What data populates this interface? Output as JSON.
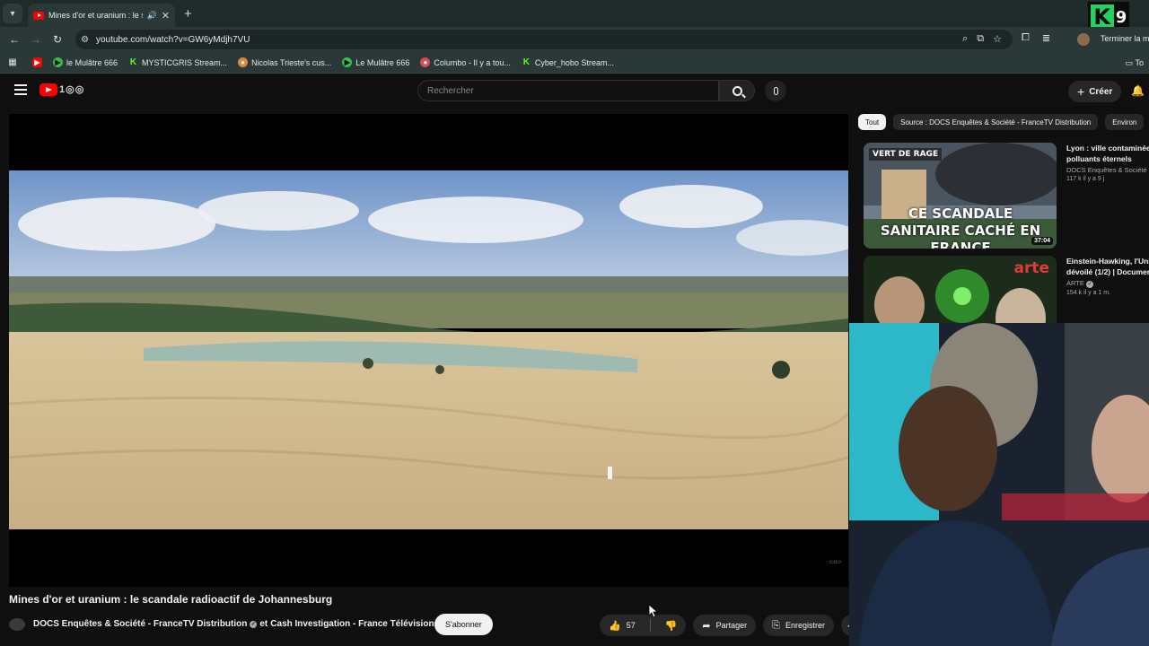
{
  "browser": {
    "tab": {
      "title": "Mines d'or et uranium : le s",
      "favicon": "youtube-icon"
    },
    "url": "youtube.com/watch?v=GW6yMdjh7VU",
    "profile_action": "Terminer la m",
    "bookmarks": [
      {
        "label": "",
        "icon": "youtube-icon"
      },
      {
        "label": "le Mulâtre 666",
        "icon": "play-icon"
      },
      {
        "label": "MYSTICGRIS Stream...",
        "icon": "kick-icon"
      },
      {
        "label": "Nicolas Trieste's cus...",
        "icon": "fox-icon"
      },
      {
        "label": "Le Mulâtre 666",
        "icon": "play-icon"
      },
      {
        "label": "Columbo - Il y a tou...",
        "icon": "circle-icon"
      },
      {
        "label": "Cyber_hobo Stream...",
        "icon": "kick-icon"
      }
    ],
    "bookmarks_more": "To"
  },
  "overlay_logo": {
    "letter": "K",
    "number": "9"
  },
  "youtube": {
    "search": {
      "placeholder": "Rechercher"
    },
    "create_label": "Créer",
    "video": {
      "title": "Mines d'or et uranium : le scandale radioactif de Johannesburg",
      "channel_1": "DOCS Enquêtes & Société - FranceTV Distribution",
      "joiner": "et",
      "channel_2": "Cash Investigation - France Télévisions",
      "subscribe_label": "S'abonner",
      "likes": "57",
      "share_label": "Partager",
      "save_label": "Enregistrer"
    },
    "chips": [
      {
        "label": "Tout",
        "active": true
      },
      {
        "label": "Source : DOCS Enquêtes & Société - FranceTV Distribution",
        "active": false
      },
      {
        "label": "Environ",
        "active": false
      }
    ],
    "recommendations": [
      {
        "title_line1": "Lyon : ville contaminée",
        "title_line2": "polluants éternels",
        "channel": "DOCS Enquêtes & Société -",
        "stats": "117 k  il y a 9 j",
        "thumb_tag": "VERT DE RAGE",
        "thumb_caption": "CE SCANDALE SANITAIRE CACHÉ EN FRANCE",
        "duration": "37:04"
      },
      {
        "title_line1": "Einstein-Hawking, l'Univ",
        "title_line2": "dévoilé (1/2) | Documen",
        "channel": "ARTE",
        "stats": "154 k  il y a 1 m.",
        "thumb_brand": "arte"
      }
    ]
  },
  "colors": {
    "accent": "#ff0000",
    "kick_green": "#53fc18",
    "page_bg": "#0f0f0f",
    "browser_chrome": "#2b3838"
  }
}
